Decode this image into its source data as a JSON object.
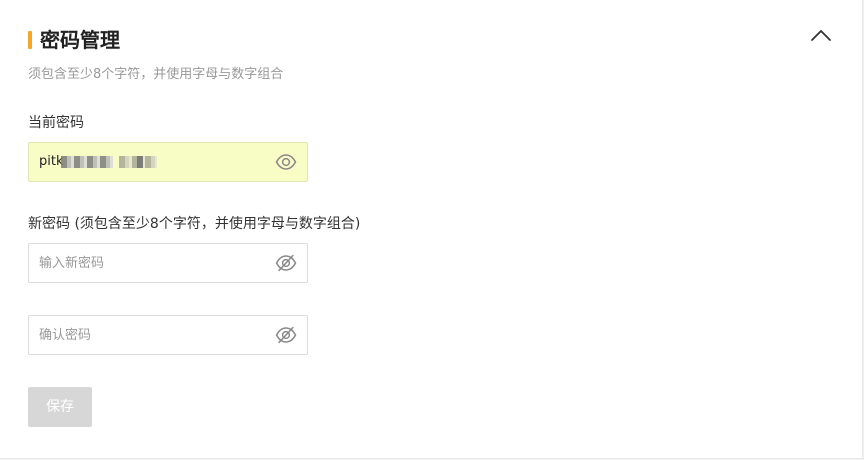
{
  "section": {
    "title": "密码管理",
    "hint": "须包含至少8个字符，并使用字母与数字组合",
    "accent_color": "#f5a623",
    "collapse_icon": "chevron-up-icon"
  },
  "current_password": {
    "label": "当前密码",
    "value_visible": "pitk",
    "autofill_background": "#f8fdc6",
    "toggle_icon": "eye-icon"
  },
  "new_password": {
    "label": "新密码 (须包含至少8个字符，并使用字母与数字组合)",
    "placeholder": "输入新密码",
    "toggle_icon": "eye-off-icon"
  },
  "confirm_password": {
    "placeholder": "确认密码",
    "toggle_icon": "eye-off-icon"
  },
  "actions": {
    "save_label": "保存",
    "save_disabled_color": "#d7d7d7"
  }
}
